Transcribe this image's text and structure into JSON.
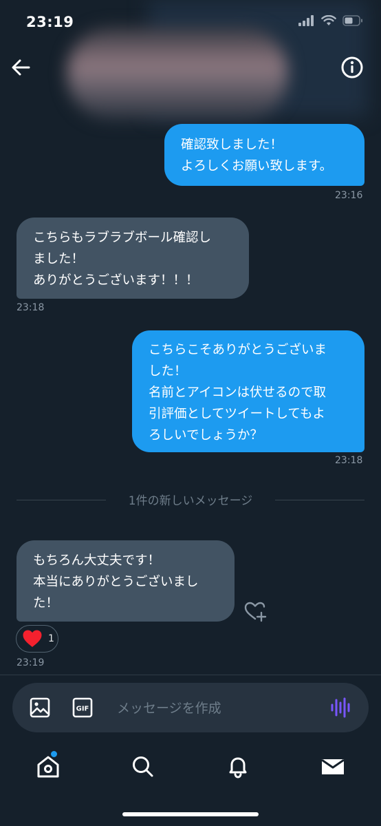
{
  "status_bar": {
    "time": "23:19",
    "icons": [
      "signal-icon",
      "wifi-icon",
      "battery-icon"
    ]
  },
  "header": {
    "back_icon": "arrow-left-icon",
    "info_icon": "info-icon"
  },
  "messages": [
    {
      "direction": "sent",
      "text": "確認致しました！\nよろしくお願い致します。",
      "time": "23:16"
    },
    {
      "direction": "received",
      "text": "こちらもラブラブボール確認し\nました！\nありがとうございます！！！",
      "time": "23:18"
    },
    {
      "direction": "sent",
      "text": "こちらこそありがとうございま\nした！\n名前とアイコンは伏せるので取\n引評価としてツイートしてもよ\nろしいでしょうか？",
      "time": "23:18"
    },
    {
      "direction": "received",
      "text": "もちろん大丈夫です！\n本当にありがとうございまし\nた！",
      "time": "23:19",
      "reaction": {
        "emoji": "heart-icon",
        "count": "1"
      }
    }
  ],
  "divider": {
    "text": "1件の新しいメッセージ"
  },
  "composer": {
    "placeholder": "メッセージを作成",
    "media_icon": "image-icon",
    "gif_label": "GIF",
    "voice_icon": "voice-wave-icon"
  },
  "nav": {
    "items": [
      "home-icon",
      "search-icon",
      "bell-icon",
      "mail-icon"
    ]
  },
  "colors": {
    "background": "#15202b",
    "sent_bubble": "#1d9bf0",
    "received_bubble": "#425363",
    "heart": "#f91880",
    "voice": "#7856ff"
  }
}
